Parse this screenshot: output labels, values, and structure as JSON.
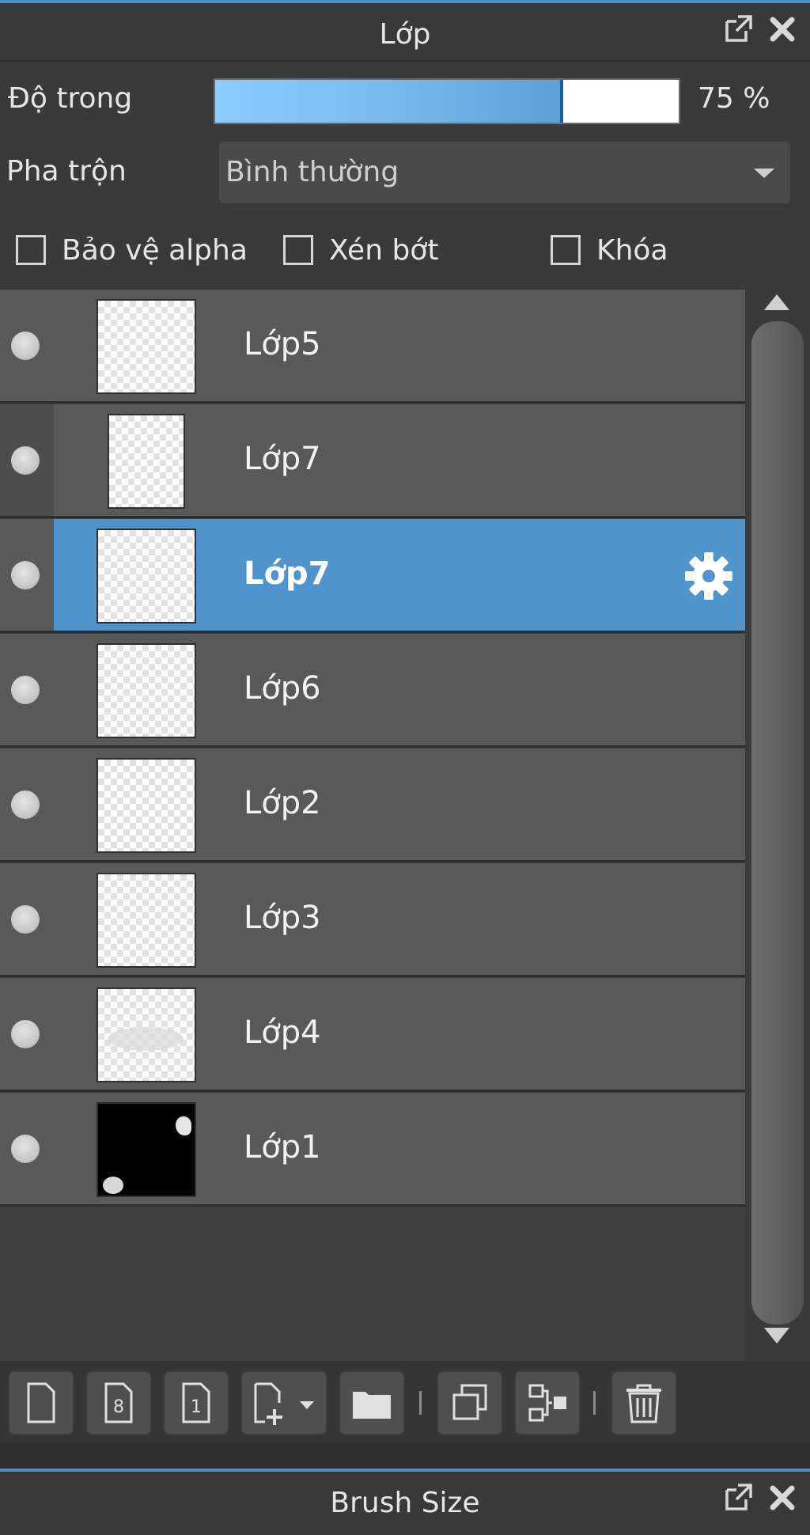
{
  "panel": {
    "title": "Lớp",
    "float_icon": "popout-icon",
    "close_icon": "close-icon"
  },
  "opacity": {
    "label": "Độ trong",
    "value_text": "75 %",
    "value": 0.75
  },
  "blend": {
    "label": "Pha trộn",
    "value": "Bình thường"
  },
  "checkboxes": {
    "protect_alpha": {
      "label": "Bảo vệ alpha",
      "checked": false
    },
    "clip": {
      "label": "Xén bớt",
      "checked": false
    },
    "lock": {
      "label": "Khóa",
      "checked": false
    }
  },
  "layers": [
    {
      "name": "Lớp5",
      "visible": true,
      "selected": false
    },
    {
      "name": "Lớp7",
      "visible": true,
      "selected": false
    },
    {
      "name": "Lớp7",
      "visible": true,
      "selected": true
    },
    {
      "name": "Lớp6",
      "visible": true,
      "selected": false
    },
    {
      "name": "Lớp2",
      "visible": true,
      "selected": false
    },
    {
      "name": "Lớp3",
      "visible": true,
      "selected": false
    },
    {
      "name": "Lớp4",
      "visible": true,
      "selected": false
    },
    {
      "name": "Lớp1",
      "visible": true,
      "selected": false
    }
  ],
  "toolbar": {
    "icons": [
      "new-layer-icon",
      "new-8bit-layer-icon",
      "new-1bit-layer-icon",
      "add-layer-dropdown-icon",
      "folder-icon",
      "duplicate-layer-icon",
      "merge-down-icon",
      "delete-icon"
    ]
  },
  "bottom_panel": {
    "title": "Brush Size"
  },
  "colors": {
    "accent": "#4f94cc",
    "row": "#595959",
    "background": "#3a3a3a"
  }
}
